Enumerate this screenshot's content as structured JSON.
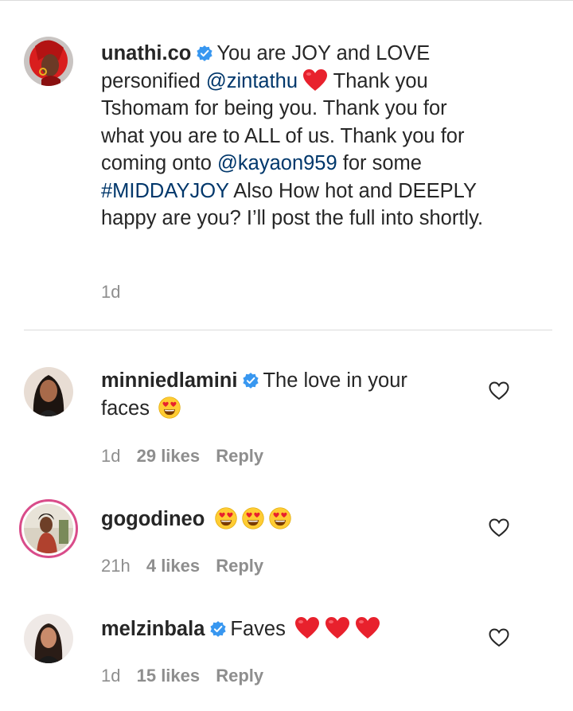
{
  "caption": {
    "username": "unathi.co",
    "text_1": "You are JOY and LOVE personified ",
    "mention_1": "@zintathu",
    "text_2": " Thank you Tshomam for being you. Thank you for what you are to ALL of us. Thank you for coming onto ",
    "mention_2": "@kayaon959",
    "text_3": " for some ",
    "hashtag": "#MIDDAYJOY",
    "text_4": " Also How hot and DEEPLY happy are you? I’ll post the full into shortly.",
    "time": "1d"
  },
  "comments": [
    {
      "username": "minniedlamini",
      "text": "The love in your faces",
      "time": "1d",
      "likes": "29 likes",
      "reply": "Reply"
    },
    {
      "username": "gogodineo",
      "text": "",
      "time": "21h",
      "likes": "4 likes",
      "reply": "Reply"
    },
    {
      "username": "melzinbala",
      "text": "Faves",
      "time": "1d",
      "likes": "15 likes",
      "reply": "Reply"
    }
  ],
  "icons": {
    "verified": "verified-badge-icon",
    "like": "heart-outline-icon",
    "heart_emoji": "red-heart-emoji",
    "heart_eyes_emoji": "heart-eyes-emoji"
  },
  "colors": {
    "verified_blue": "#3897f0",
    "link": "#00376b",
    "meta_gray": "#8e8e8e",
    "story_ring": "#d94c8a"
  }
}
